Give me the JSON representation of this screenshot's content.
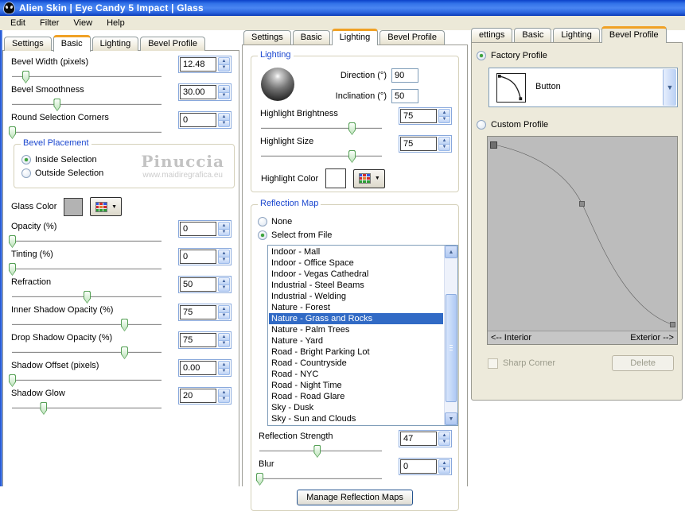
{
  "colors": {
    "titlebar_blue": "#2f6ce4",
    "active_tab_accent": "#f0a125",
    "selection_blue": "#316ac5",
    "group_title_blue": "#1b47cf",
    "glass_color_swatch": "#b3b3b3",
    "highlight_color_swatch": "#ffffff"
  },
  "window": {
    "title": "Alien Skin  |  Eye Candy 5 Impact  |  Glass"
  },
  "menu": {
    "items": [
      "Edit",
      "Filter",
      "View",
      "Help"
    ]
  },
  "left": {
    "tabs": [
      {
        "label": "Settings",
        "active": false
      },
      {
        "label": "Basic",
        "active": true
      },
      {
        "label": "Lighting",
        "active": false
      },
      {
        "label": "Bevel Profile",
        "active": false
      }
    ],
    "sliders_top": [
      {
        "label": "Bevel Width (pixels)",
        "value": "12.48",
        "pos": 9
      },
      {
        "label": "Bevel Smoothness",
        "value": "30.00",
        "pos": 30
      },
      {
        "label": "Round Selection Corners",
        "value": "0",
        "pos": 0
      }
    ],
    "bevel_placement": {
      "title": "Bevel Placement",
      "radios": [
        {
          "label": "Inside Selection",
          "selected": true
        },
        {
          "label": "Outside Selection",
          "selected": false
        }
      ]
    },
    "watermark": {
      "line1": "Pinuccia",
      "line2": "www.maidiregrafica.eu"
    },
    "glass_color_label": "Glass Color",
    "sliders_bottom": [
      {
        "label": "Opacity (%)",
        "value": "0",
        "pos": 0
      },
      {
        "label": "Tinting (%)",
        "value": "0",
        "pos": 0
      },
      {
        "label": "Refraction",
        "value": "50",
        "pos": 50
      },
      {
        "label": "Inner Shadow Opacity (%)",
        "value": "75",
        "pos": 75
      },
      {
        "label": "Drop Shadow Opacity (%)",
        "value": "75",
        "pos": 75
      },
      {
        "label": "Shadow Offset (pixels)",
        "value": "0.00",
        "pos": 0
      },
      {
        "label": "Shadow Glow",
        "value": "20",
        "pos": 21
      }
    ]
  },
  "middle": {
    "tabs": [
      {
        "label": "Settings",
        "active": false
      },
      {
        "label": "Basic",
        "active": false
      },
      {
        "label": "Lighting",
        "active": true
      },
      {
        "label": "Bevel Profile",
        "active": false
      }
    ],
    "lighting": {
      "title": "Lighting",
      "direction_label": "Direction (°)",
      "direction_value": "90",
      "inclination_label": "Inclination (°)",
      "inclination_value": "50",
      "sliders": [
        {
          "label": "Highlight Brightness",
          "value": "75",
          "pos": 75
        },
        {
          "label": "Highlight Size",
          "value": "75",
          "pos": 75
        }
      ],
      "highlight_color_label": "Highlight Color"
    },
    "reflection": {
      "title": "Reflection Map",
      "radios": [
        {
          "label": "None",
          "selected": false
        },
        {
          "label": "Select from File",
          "selected": true
        }
      ],
      "list": {
        "items": [
          "Indoor - Mall",
          "Indoor - Office Space",
          "Indoor - Vegas Cathedral",
          "Industrial - Steel Beams",
          "Industrial - Welding",
          "Nature - Forest",
          "Nature - Grass and Rocks",
          "Nature - Palm Trees",
          "Nature - Yard",
          "Road - Bright Parking Lot",
          "Road - Countryside",
          "Road - NYC",
          "Road - Night Time",
          "Road - Road Glare",
          "Sky - Dusk",
          "Sky - Sun and Clouds"
        ],
        "selected": "Nature - Grass and Rocks"
      },
      "sliders": [
        {
          "label": "Reflection Strength",
          "value": "47",
          "pos": 47
        },
        {
          "label": "Blur",
          "value": "0",
          "pos": 0
        }
      ],
      "manage_button": "Manage Reflection Maps"
    }
  },
  "right": {
    "tabs": [
      {
        "label": "ettings",
        "active": false
      },
      {
        "label": "Basic",
        "active": false
      },
      {
        "label": "Lighting",
        "active": false
      },
      {
        "label": "Bevel Profile",
        "active": true
      }
    ],
    "factory": {
      "label": "Factory Profile",
      "selected": true,
      "dropdown_value": "Button"
    },
    "custom": {
      "label": "Custom Profile",
      "selected": false
    },
    "curve": {
      "handles": [
        {
          "x": 3,
          "y": 4
        },
        {
          "x": 50,
          "y": 35
        },
        {
          "x": 98,
          "y": 97
        }
      ],
      "interior_label": "<-- Interior",
      "exterior_label": "Exterior -->"
    },
    "sharp_corner_label": "Sharp Corner",
    "delete_button": "Delete"
  }
}
